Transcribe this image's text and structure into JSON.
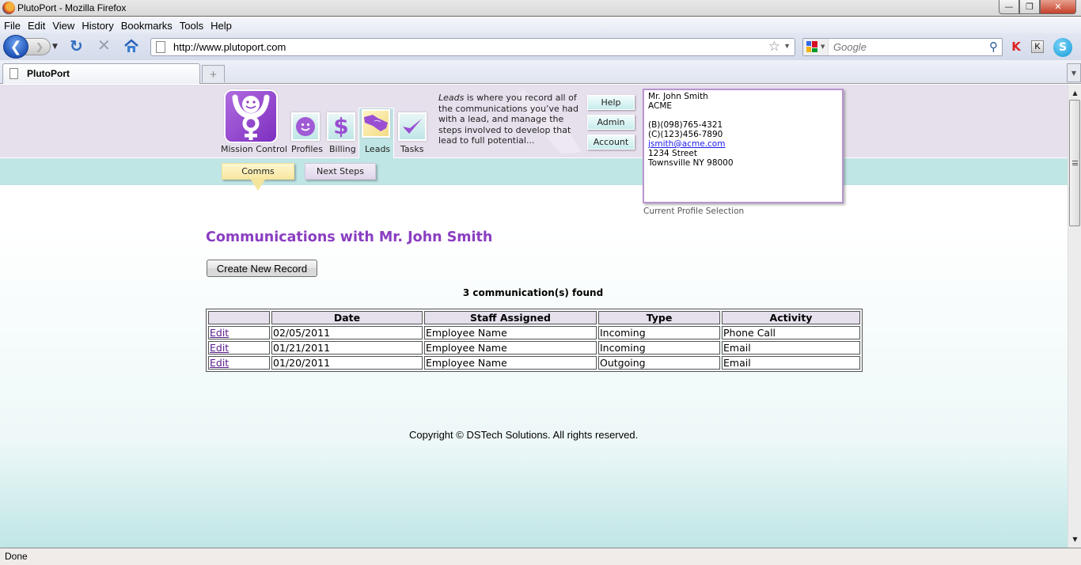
{
  "window": {
    "title": "PlutoPort - Mozilla Firefox",
    "controls": {
      "minimize": "—",
      "restore": "❐",
      "close": "✕"
    }
  },
  "menubar": [
    "File",
    "Edit",
    "View",
    "History",
    "Bookmarks",
    "Tools",
    "Help"
  ],
  "navbar": {
    "url": "http://www.plutoport.com",
    "search_placeholder": "Google",
    "icons": [
      "back-icon",
      "forward-icon",
      "history-dropdown-icon",
      "reload-icon",
      "stop-icon",
      "home-icon",
      "bookmark-star-icon",
      "search-engine-icon",
      "search-icon",
      "kaspersky-icon",
      "keyboard-icon",
      "skype-icon"
    ]
  },
  "tabs": [
    {
      "label": "PlutoPort",
      "active": true
    }
  ],
  "new_tab_label": "+",
  "app": {
    "logo_label": "Mission Control",
    "nav": [
      {
        "label": "Profiles",
        "icon": "smiley-icon",
        "active": false
      },
      {
        "label": "Billing",
        "icon": "dollar-icon",
        "active": false
      },
      {
        "label": "Leads",
        "icon": "handshake-icon",
        "active": true
      },
      {
        "label": "Tasks",
        "icon": "checkmark-icon",
        "active": false
      }
    ],
    "subtabs": [
      {
        "label": "Comms",
        "active": true
      },
      {
        "label": "Next Steps",
        "active": false
      }
    ],
    "description": {
      "lead_word": "Leads",
      "text": " is where you record all of the communications you’ve had with a lead, and manage the steps involved to develop that lead to full potential..."
    },
    "side_buttons": [
      "Help",
      "Admin",
      "Account"
    ],
    "profile": {
      "name": "Mr. John Smith",
      "company": "ACME",
      "business_phone": "(B)(098)765-4321",
      "cell_phone": "(C)(123)456-7890",
      "email": "jsmith@acme.com",
      "street": "1234 Street",
      "city_line": "Townsville NY 98000",
      "caption": "Current Profile Selection"
    },
    "colors": {
      "header_bg": "#e6dfec",
      "subbar_bg": "#bfe5e4",
      "title_purple": "#8a3ec1",
      "link_visited": "#551a8b"
    }
  },
  "main": {
    "title": "Communications with Mr. John Smith",
    "create_button": "Create New Record",
    "found_text": "3 communication(s) found",
    "table": {
      "headers": [
        "",
        "Date",
        "Staff Assigned",
        "Type",
        "Activity"
      ],
      "rows": [
        {
          "action": "Edit",
          "date": "02/05/2011",
          "staff": "Employee Name",
          "type": "Incoming",
          "activity": "Phone Call"
        },
        {
          "action": "Edit",
          "date": "01/21/2011",
          "staff": "Employee Name",
          "type": "Incoming",
          "activity": "Email"
        },
        {
          "action": "Edit",
          "date": "01/20/2011",
          "staff": "Employee Name",
          "type": "Outgoing",
          "activity": "Email"
        }
      ]
    },
    "copyright": "Copyright © DSTech Solutions. All rights reserved."
  },
  "statusbar": {
    "text": "Done"
  }
}
